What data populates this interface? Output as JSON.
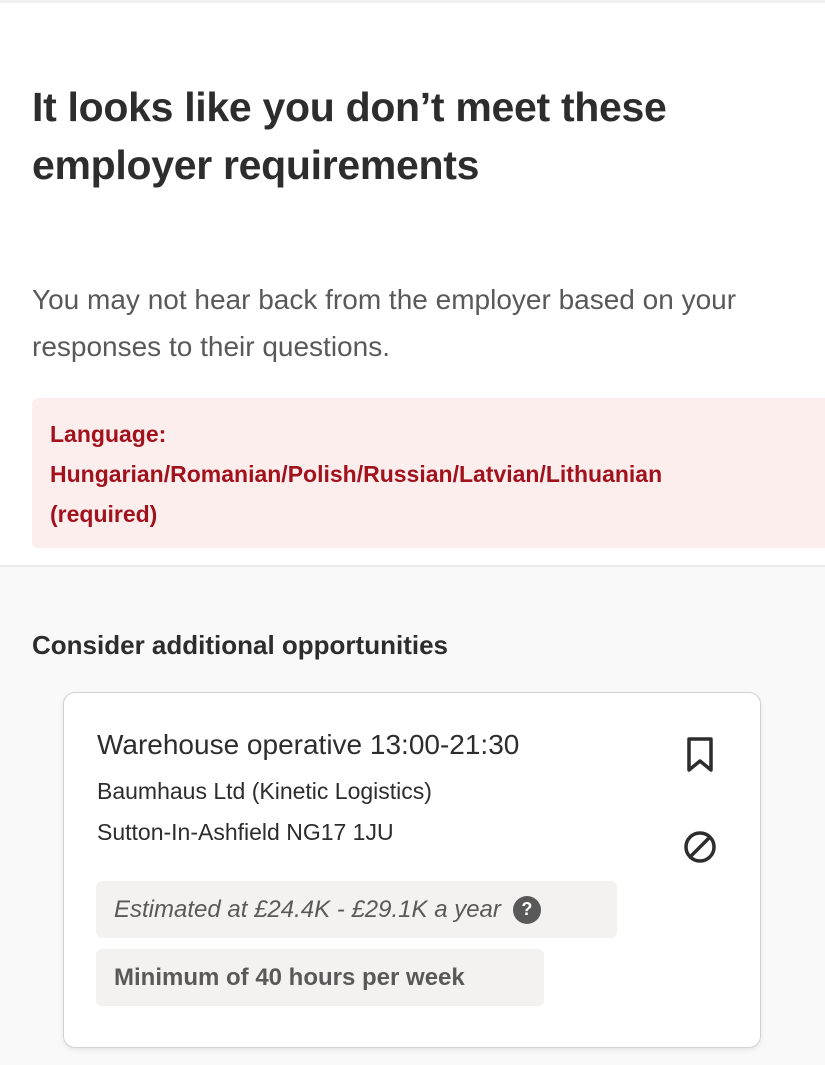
{
  "header": {
    "headline": "It looks like you don’t meet these employer requirements",
    "subtext": "You may not hear back from the employer based on your responses to their questions."
  },
  "requirement_alert": {
    "text": "Language:\nHungarian/Romanian/Polish/Russian/Latvian/Lithuanian\n(required)"
  },
  "opportunities": {
    "section_title": "Consider additional opportunities",
    "job": {
      "title": "Warehouse operative 13:00-21:30",
      "company": "Baumhaus Ltd (Kinetic Logistics)",
      "location": "Sutton-In-Ashfield NG17 1JU",
      "salary": "Estimated at £24.4K - £29.1K a year",
      "salary_help_icon": "?",
      "hours": "Minimum of 40 hours per week",
      "icons": [
        "bookmark-icon",
        "not-interested-icon",
        "help-icon"
      ]
    }
  },
  "colors": {
    "alert_background": "#fdeeee",
    "alert_text": "#a2121d",
    "primary_text": "#2d2d2d",
    "secondary_text": "#595959"
  }
}
